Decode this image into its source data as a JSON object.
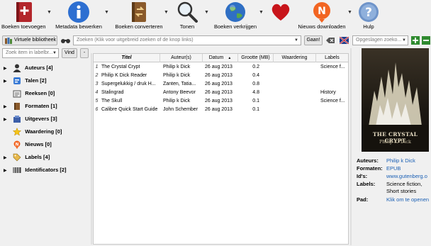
{
  "toolbar": {
    "add_books": "Boeken toevoegen",
    "edit_metadata": "Metadata bewerken",
    "convert_books": "Boeken converteren",
    "view": "Tonen",
    "get_books": "Boeken verkrijgen",
    "news": "Nieuws downloaden",
    "help": "Hulp"
  },
  "search": {
    "virtual_library": "Virtuele bibliotheek",
    "placeholder": "Zoeken (Klik voor uitgebreid zoeken of de knop links)",
    "go": "Gaan!",
    "saved_searches_placeholder": "Opgeslagen zoeko...",
    "find_items_placeholder": "Zoek item in labelbr...",
    "find_button": "Vind",
    "minus_button": "-"
  },
  "tree": [
    {
      "label": "Auteurs [4]",
      "icon": "user-icon"
    },
    {
      "label": "Talen [2]",
      "icon": "languages-icon"
    },
    {
      "label": "Reeksen [0]",
      "icon": "series-icon"
    },
    {
      "label": "Formaten [1]",
      "icon": "book-icon"
    },
    {
      "label": "Uitgevers [3]",
      "icon": "publisher-icon"
    },
    {
      "label": "Waardering [0]",
      "icon": "star-icon"
    },
    {
      "label": "Nieuws [0]",
      "icon": "news-icon"
    },
    {
      "label": "Labels [4]",
      "icon": "tag-icon"
    },
    {
      "label": "Identificators [2]",
      "icon": "barcode-icon"
    }
  ],
  "table": {
    "headers": [
      "Titel",
      "Auteur(s)",
      "Datum",
      "Grootte (MB)",
      "Waardering",
      "Labels"
    ],
    "rows": [
      {
        "n": "1",
        "title": "The Crystal Crypt",
        "author": "Philip k Dick",
        "date": "26 aug 2013",
        "size": "0.2",
        "labels": "Science f..."
      },
      {
        "n": "2",
        "title": "Philip K Dick Reader",
        "author": "Philip k Dick",
        "date": "26 aug 2013",
        "size": "0.4",
        "labels": ""
      },
      {
        "n": "3",
        "title": "Supergelukkig / druk H...",
        "author": "Zanten, Tatia...",
        "date": "26 aug 2013",
        "size": "0.8",
        "labels": ""
      },
      {
        "n": "4",
        "title": "Stalingrad",
        "author": "Antony Beevor",
        "date": "26 aug 2013",
        "size": "4.8",
        "labels": "History"
      },
      {
        "n": "5",
        "title": "The Skull",
        "author": "Philip k Dick",
        "date": "26 aug 2013",
        "size": "0.1",
        "labels": "Science f..."
      },
      {
        "n": "6",
        "title": "Calibre Quick Start Guide",
        "author": "John Schember",
        "date": "26 aug 2013",
        "size": "0.1",
        "labels": ""
      }
    ]
  },
  "cover": {
    "title": "THE CRYSTAL CRYPT",
    "author": "Philip K. Dick"
  },
  "details": {
    "authors_key": "Auteurs:",
    "authors_val": "Philip k Dick",
    "formats_key": "Formaten:",
    "formats_val": "EPUB",
    "ids_key": "Id's:",
    "ids_val": "www.gutenberg.o",
    "labels_key": "Labels:",
    "labels_val1": "Science fiction,",
    "labels_val2": "Short stories",
    "path_key": "Pad:",
    "path_val": "Klik om te openen"
  },
  "colors": {
    "link": "#1a5fb4",
    "selection": "#3399ff"
  }
}
